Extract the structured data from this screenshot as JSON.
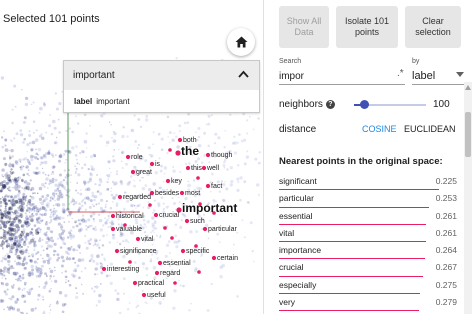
{
  "projection": {
    "selected_count": "Selected 101 points",
    "labels": [
      {
        "text": "both",
        "big": false
      },
      {
        "text": "the",
        "big": true
      },
      {
        "text": "though",
        "big": false
      },
      {
        "text": "role",
        "big": false
      },
      {
        "text": "is",
        "big": false
      },
      {
        "text": "this",
        "big": false
      },
      {
        "text": "well",
        "big": false
      },
      {
        "text": "great",
        "big": false
      },
      {
        "text": "key",
        "big": false
      },
      {
        "text": "fact",
        "big": false
      },
      {
        "text": "regarded",
        "big": false
      },
      {
        "text": "besides",
        "big": false
      },
      {
        "text": "most",
        "big": false
      },
      {
        "text": "important",
        "big": true
      },
      {
        "text": "historical",
        "big": false
      },
      {
        "text": "crucial",
        "big": false
      },
      {
        "text": "such",
        "big": false
      },
      {
        "text": "valuable",
        "big": false
      },
      {
        "text": "particular",
        "big": false
      },
      {
        "text": "vital",
        "big": false
      },
      {
        "text": "significance",
        "big": false
      },
      {
        "text": "specific",
        "big": false
      },
      {
        "text": "essential",
        "big": false
      },
      {
        "text": "certain",
        "big": false
      },
      {
        "text": "interesting",
        "big": false
      },
      {
        "text": "regard",
        "big": false
      },
      {
        "text": "practical",
        "big": false
      },
      {
        "text": "useful",
        "big": false
      }
    ]
  },
  "popup": {
    "title": "important",
    "field_key": "label",
    "field_value": "important"
  },
  "toolbar": {
    "show_all": "Show All Data",
    "isolate": "Isolate 101 points",
    "clear": "Clear selection"
  },
  "search": {
    "label": "Search",
    "value": "impor",
    "regex_symbol": ".*",
    "by_label": "by",
    "by_value": "label"
  },
  "neighbors": {
    "label": "neighbors",
    "value": "100",
    "fraction": 0.1
  },
  "distance": {
    "label": "distance",
    "cosine": "COSINE",
    "euclidean": "EUCLIDEAN"
  },
  "nearest": {
    "title": "Nearest points in the original space:",
    "items": [
      {
        "word": "significant",
        "dist": "0.225",
        "score": 0.225
      },
      {
        "word": "particular",
        "dist": "0.253",
        "score": 0.253
      },
      {
        "word": "essential",
        "dist": "0.261",
        "score": 0.261
      },
      {
        "word": "vital",
        "dist": "0.261",
        "score": 0.261
      },
      {
        "word": "importance",
        "dist": "0.264",
        "score": 0.264
      },
      {
        "word": "crucial",
        "dist": "0.267",
        "score": 0.267
      },
      {
        "word": "especially",
        "dist": "0.275",
        "score": 0.275
      },
      {
        "word": "very",
        "dist": "0.279",
        "score": 0.279
      }
    ]
  },
  "colors": {
    "accent": "#e91e63",
    "cloud": "#1a237e",
    "link": "#1e88e5"
  }
}
